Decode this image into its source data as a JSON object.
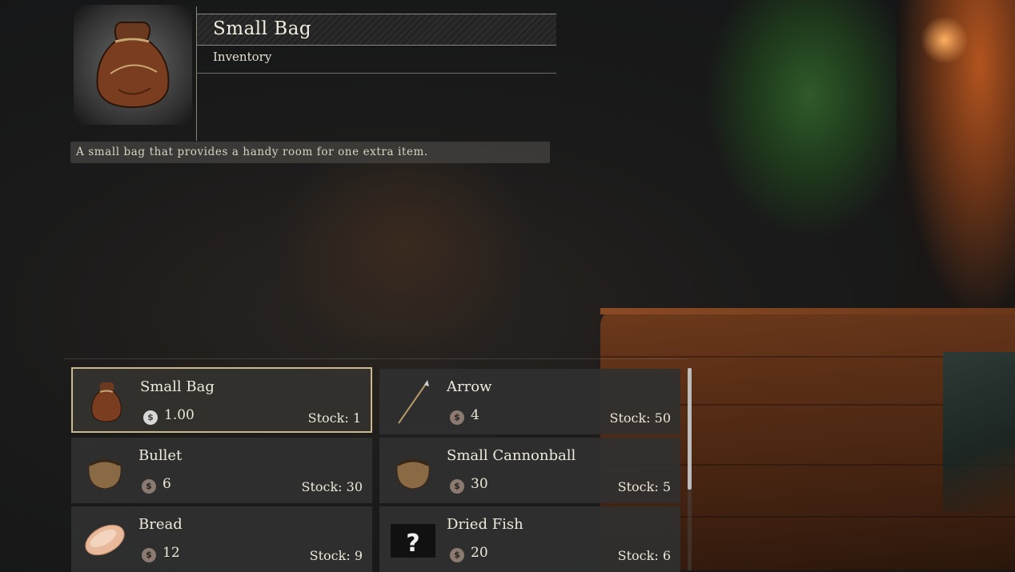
{
  "details": {
    "title": "Small Bag",
    "category": "Inventory",
    "description": "A small bag that provides a handy room for one extra item.",
    "icon": "small-bag-icon"
  },
  "shop": {
    "items": [
      {
        "name": "Small Bag",
        "price": "1.00",
        "stock": "Stock: 1",
        "icon": "small-bag-icon",
        "currency": "silver-coin",
        "selected": true
      },
      {
        "name": "Arrow",
        "price": "4",
        "stock": "Stock: 50",
        "icon": "arrow-icon",
        "currency": "copper-coin"
      },
      {
        "name": "Bullet",
        "price": "6",
        "stock": "Stock: 30",
        "icon": "bullet-pouch-icon",
        "currency": "copper-coin"
      },
      {
        "name": "Small Cannonball",
        "price": "30",
        "stock": "Stock: 5",
        "icon": "cannonball-pouch-icon",
        "currency": "copper-coin"
      },
      {
        "name": "Bread",
        "price": "12",
        "stock": "Stock: 9",
        "icon": "bread-icon",
        "currency": "copper-coin"
      },
      {
        "name": "Dried Fish",
        "price": "20",
        "stock": "Stock: 6",
        "icon": "unknown-item-icon",
        "currency": "copper-coin"
      }
    ]
  },
  "colors": {
    "selected_border": "#c9b98c",
    "card_bg": "#303030",
    "text": "#efeadd"
  }
}
